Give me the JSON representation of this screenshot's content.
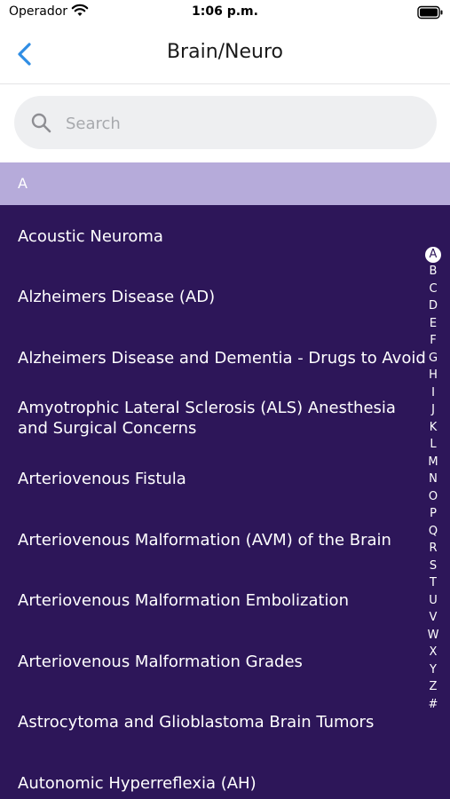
{
  "status": {
    "carrier": "Operador",
    "time": "1:06 p.m."
  },
  "nav": {
    "title": "Brain/Neuro",
    "back_icon": "chevron-left-icon"
  },
  "search": {
    "placeholder": "Search",
    "value": ""
  },
  "section": {
    "letter": "A"
  },
  "items": [
    "Acoustic Neuroma",
    "Alzheimers Disease (AD)",
    "Alzheimers Disease and Dementia - Drugs to Avoid",
    "Amyotrophic Lateral Sclerosis (ALS) Anesthesia and Surgical Concerns",
    "Arteriovenous Fistula",
    "Arteriovenous Malformation (AVM) of the Brain",
    "Arteriovenous Malformation Embolization",
    "Arteriovenous Malformation Grades",
    "Astrocytoma and Glioblastoma Brain Tumors",
    "Autonomic Hyperreflexia (AH)"
  ],
  "index": [
    "A",
    "B",
    "C",
    "D",
    "E",
    "F",
    "G",
    "H",
    "I",
    "J",
    "K",
    "L",
    "M",
    "N",
    "O",
    "P",
    "Q",
    "R",
    "S",
    "T",
    "U",
    "V",
    "W",
    "X",
    "Y",
    "Z",
    "#"
  ],
  "colors": {
    "list_background": "#2d1659",
    "section_header": "#b6abda",
    "accent": "#2f8de4"
  }
}
